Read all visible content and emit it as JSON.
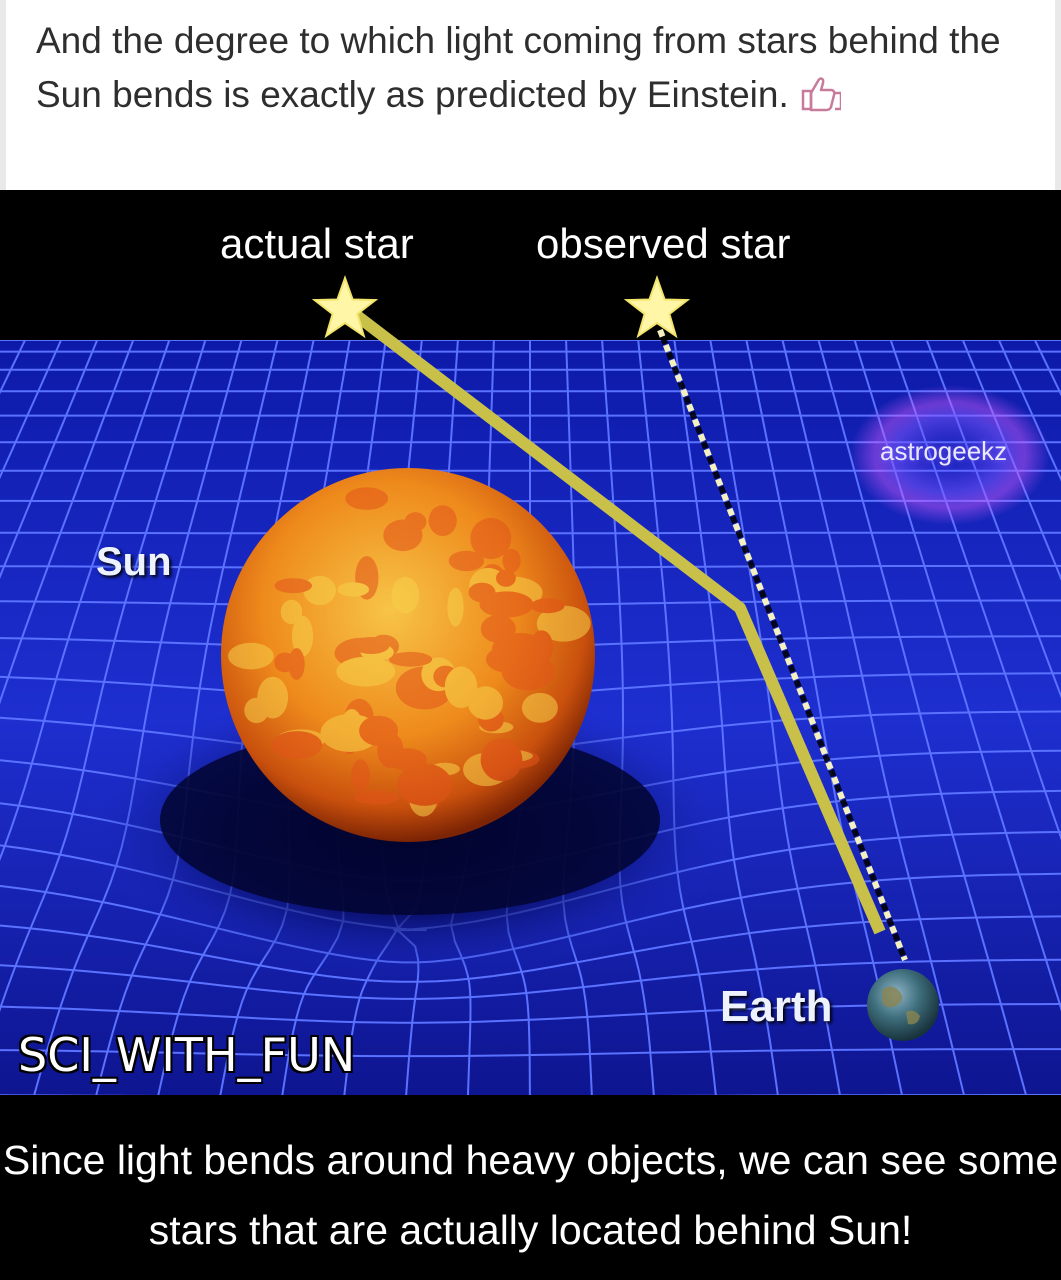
{
  "post": {
    "text": "And the degree to which light coming from stars behind the Sun bends is exactly as predicted by Einstein.",
    "emoji_icon": "thumbs-up-icon"
  },
  "diagram": {
    "labels": {
      "actual_star": "actual star",
      "observed_star": "observed star",
      "sun": "Sun",
      "earth": "Earth",
      "watermark": "astrogeekz",
      "brand": "SCI_WITH_FUN"
    },
    "colors": {
      "grid": "#3f57ff",
      "grid_background": "#1622b8",
      "light_path": "#c9c04a",
      "star": "#fff6a8",
      "sun_primary": "#f08a1e",
      "sun_highlight": "#f7d04a"
    }
  },
  "caption": {
    "text": "Since light bends around heavy objects, we can see some stars that are actually located behind Sun!"
  }
}
